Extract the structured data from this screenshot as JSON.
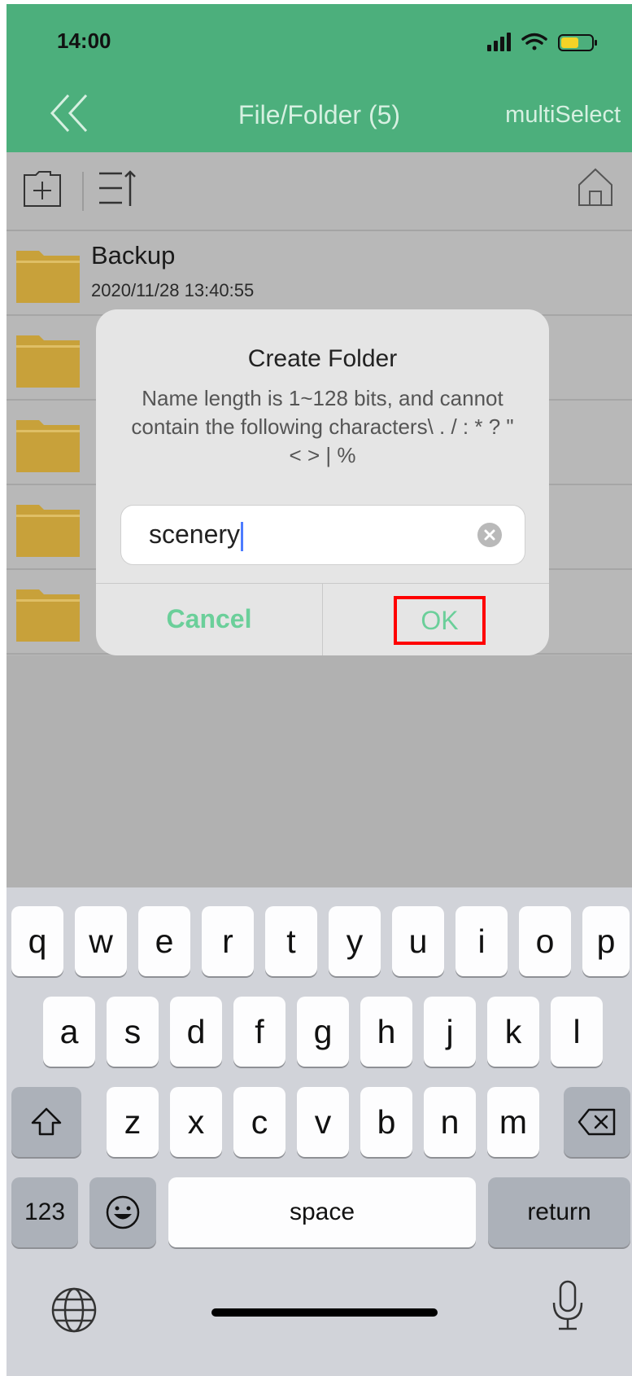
{
  "status_bar": {
    "time": "14:00"
  },
  "nav": {
    "title": "File/Folder (5)",
    "multi_select": "multiSelect",
    "back_icon": "double-chevron-left-icon"
  },
  "toolbar": {
    "new_folder_icon": "folder-add-icon",
    "sort_icon": "sort-icon",
    "home_icon": "home-icon"
  },
  "file_list": [
    {
      "name": "Backup",
      "date": "2020/11/28 13:40:55",
      "icon": "folder-icon"
    },
    {
      "name": "",
      "date": "",
      "icon": "folder-icon"
    },
    {
      "name": "",
      "date": "",
      "icon": "folder-icon"
    },
    {
      "name": "",
      "date": "",
      "icon": "folder-icon"
    },
    {
      "name": "",
      "date": "",
      "icon": "folder-icon"
    }
  ],
  "dialog": {
    "title": "Create Folder",
    "message": "Name length is 1~128 bits, and cannot contain the following characters\\ . / : * ? \" < > | %",
    "input_value": "scenery",
    "cancel_label": "Cancel",
    "ok_label": "OK",
    "accent_color": "#6bcf9a",
    "highlight_color": "#ff0000"
  },
  "keyboard": {
    "row1": [
      "q",
      "w",
      "e",
      "r",
      "t",
      "y",
      "u",
      "i",
      "o",
      "p"
    ],
    "row2": [
      "a",
      "s",
      "d",
      "f",
      "g",
      "h",
      "j",
      "k",
      "l"
    ],
    "row3": [
      "z",
      "x",
      "c",
      "v",
      "b",
      "n",
      "m"
    ],
    "numbers_label": "123",
    "space_label": "space",
    "return_label": "return"
  },
  "colors": {
    "header_bg": "#4caf7c",
    "folder": "#c8a13a"
  }
}
